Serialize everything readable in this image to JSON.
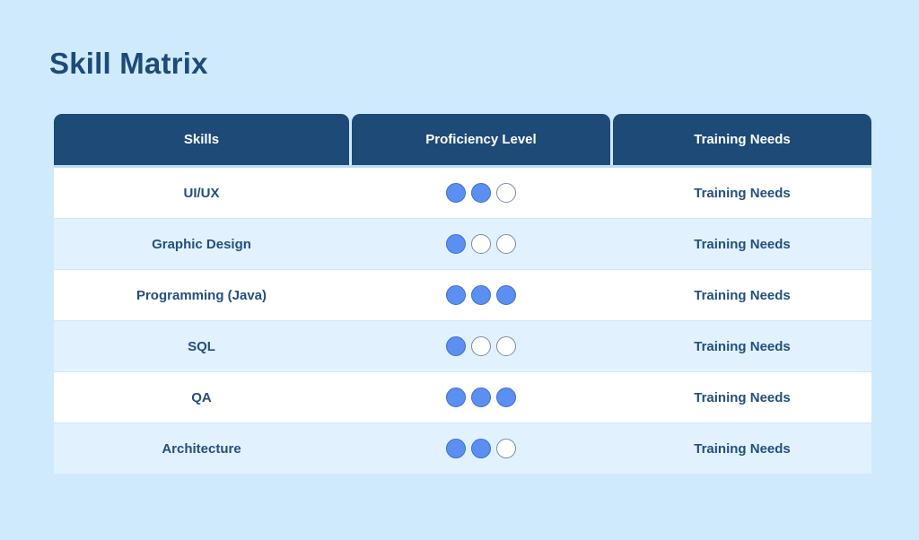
{
  "title": "Skill Matrix",
  "table": {
    "headers": {
      "skills": "Skills",
      "proficiency": "Proficiency Level",
      "training": "Training Needs"
    },
    "max_level": 3,
    "rows": [
      {
        "skill": "UI/UX",
        "proficiency": 2,
        "training": "Training Needs"
      },
      {
        "skill": "Graphic Design",
        "proficiency": 1,
        "training": "Training Needs"
      },
      {
        "skill": "Programming (Java)",
        "proficiency": 3,
        "training": "Training Needs"
      },
      {
        "skill": "SQL",
        "proficiency": 1,
        "training": "Training Needs"
      },
      {
        "skill": "QA",
        "proficiency": 3,
        "training": "Training Needs"
      },
      {
        "skill": "Architecture",
        "proficiency": 2,
        "training": "Training Needs"
      }
    ]
  },
  "colors": {
    "background": "#cfeafd",
    "header_bg": "#1d4a76",
    "title_text": "#1e4a78",
    "body_text": "#244f7e",
    "row_alt_bg": "#e1f2fe",
    "dot_filled": "#5b8ff2",
    "dot_empty_border": "#7a8ca6"
  }
}
